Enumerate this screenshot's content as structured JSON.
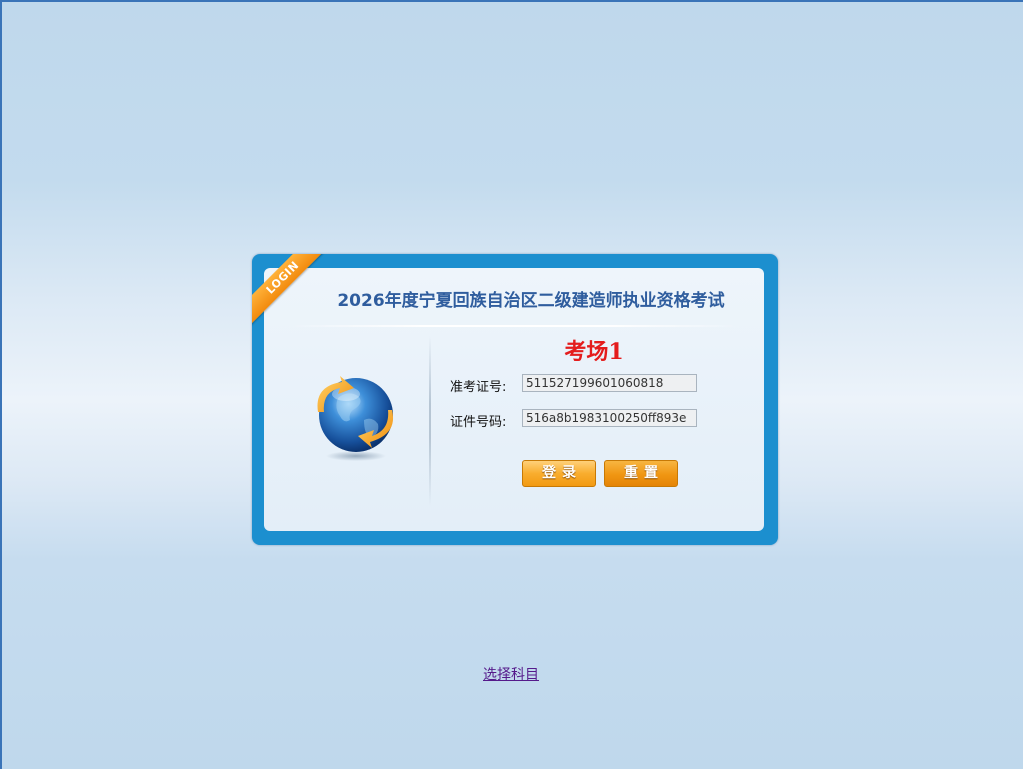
{
  "login": {
    "ribbon": "LOGIN",
    "title": "2026年度宁夏回族自治区二级建造师执业资格考试",
    "room": "考场1",
    "ticket_label": "准考证号:",
    "ticket_value": "511527199601060818",
    "id_label": "证件号码:",
    "id_value": "516a8b1983100250ff893e",
    "login_button": "登录",
    "reset_button": "重置"
  },
  "footer": {
    "choose_subject": "选择科目"
  },
  "colors": {
    "frame": "#1c8fcf",
    "title": "#2f5d9e",
    "room_title": "#e41c1c",
    "button": "#f9ad2e"
  },
  "icons": {
    "globe": "globe-icon",
    "ribbon": "login-ribbon"
  }
}
